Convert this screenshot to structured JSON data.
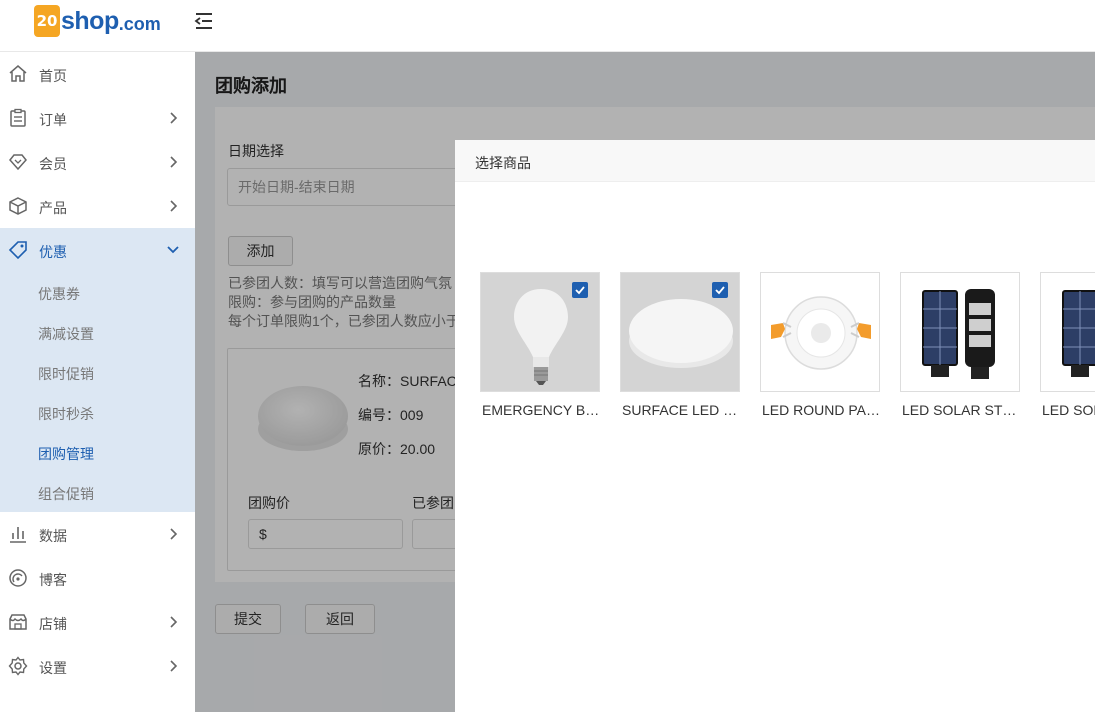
{
  "brand": {
    "logo_badge": "20",
    "logo_name": "shop",
    "logo_suffix": ".com"
  },
  "sidebar": {
    "items": [
      {
        "label": "首页",
        "icon": "home-icon"
      },
      {
        "label": "订单",
        "icon": "order-icon"
      },
      {
        "label": "会员",
        "icon": "member-icon"
      },
      {
        "label": "产品",
        "icon": "box-icon"
      },
      {
        "label": "优惠",
        "icon": "tag-icon"
      },
      {
        "label": "数据",
        "icon": "chart-icon"
      },
      {
        "label": "博客",
        "icon": "blog-icon"
      },
      {
        "label": "店铺",
        "icon": "store-icon"
      },
      {
        "label": "设置",
        "icon": "gear-icon"
      }
    ],
    "submenu": [
      "优惠券",
      "满减设置",
      "限时促销",
      "限时秒杀",
      "团购管理",
      "组合促销"
    ]
  },
  "page": {
    "title": "团购添加",
    "date_label": "日期选择",
    "date_placeholder": "开始日期-结束日期",
    "add_button": "添加",
    "hints": [
      "已参团人数：填写可以营造团购气氛",
      "限购：参与团购的产品数量",
      "每个订单限购1个，已参团人数应小于"
    ],
    "product": {
      "name": "名称：SURFAC",
      "code": "编号：009",
      "price": "原价：20.00"
    },
    "group_price_label": "团购价",
    "joined_label": "已参团",
    "group_price_value": "$",
    "submit_button": "提交",
    "back_button": "返回"
  },
  "modal": {
    "title": "选择商品",
    "goods": [
      {
        "name": "EMERGENCY BULB",
        "selected": true
      },
      {
        "name": "SURFACE LED ROUND",
        "selected": true
      },
      {
        "name": "LED ROUND PANEL",
        "selected": false
      },
      {
        "name": "LED SOLAR STREET",
        "selected": false
      },
      {
        "name": "LED SOLAR",
        "selected": false
      }
    ]
  },
  "colors": {
    "accent": "#1e5fb0",
    "logo_orange": "#f5a623",
    "active_bg": "#dce7f3"
  }
}
